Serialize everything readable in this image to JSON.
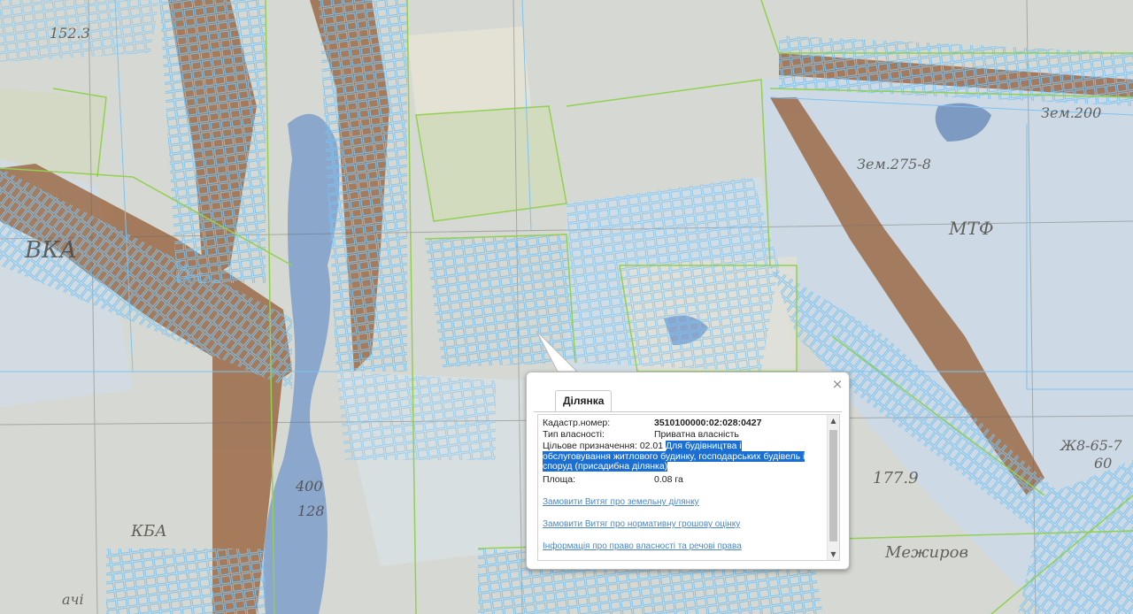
{
  "map": {
    "labels": [
      "Зем.275-8",
      "МТФ",
      "Зем.200",
      "400",
      "128",
      "177.9",
      "Межиров",
      "Ж8-65-7",
      "152.3",
      "ВКА",
      "ачі",
      "КБА",
      "60"
    ]
  },
  "popup": {
    "close_label": "×",
    "tab_label": "Ділянка",
    "fields": {
      "cadastral_label": "Кадастр.номер:",
      "cadastral_value": "3510100000:02:028:0427",
      "ownership_label": "Тип власності:",
      "ownership_value": "Приватна власність",
      "purpose_label": "Цільове призначення:",
      "purpose_code": "02.01",
      "purpose_text": "Для будівництва і обслуговування житлового будинку, господарських будівель і споруд (присадибна ділянка)",
      "area_label": "Площа:",
      "area_value": "0.08 га"
    },
    "links": {
      "extract_land": "Замовити Витяг про земельну ділянку",
      "extract_valuation": "Замовити Витяг про нормативну грошову оцінку",
      "ownership_info": "Інформація про право власності та речові права"
    },
    "scroll_up": "▲",
    "scroll_down": "▼"
  },
  "colors": {
    "parcel_outline": "#7cc3f0",
    "boundary": "#92d050",
    "water": "#8aa6cc",
    "settlement": "#9a6642",
    "selection": "#1b6fd2",
    "link": "#4a88c9"
  }
}
